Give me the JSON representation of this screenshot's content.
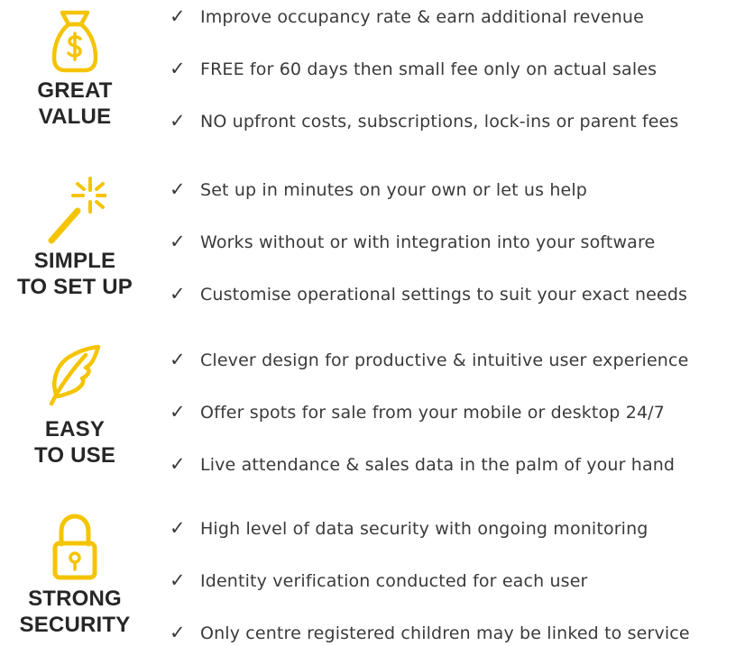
{
  "colors": {
    "accent": "#F5C400",
    "heading": "#262626",
    "body_text": "#3A3A3A"
  },
  "sections": [
    {
      "icon": "money-bag-icon",
      "label_lines": [
        "GREAT",
        "VALUE"
      ],
      "bullets": [
        "Improve occupancy rate & earn additional revenue",
        "FREE for 60 days then small fee only on actual sales",
        "NO upfront costs, subscriptions, lock-ins or parent fees"
      ]
    },
    {
      "icon": "magic-wand-icon",
      "label_lines": [
        "SIMPLE",
        "TO SET UP"
      ],
      "bullets": [
        "Set up in minutes on your own or let us help",
        "Works without or with integration into your software",
        "Customise operational settings to suit your exact needs"
      ]
    },
    {
      "icon": "feather-icon",
      "label_lines": [
        "EASY",
        "TO USE"
      ],
      "bullets": [
        "Clever design for productive & intuitive user experience",
        "Offer spots for sale from your mobile or desktop 24/7",
        "Live attendance & sales data in the palm of your hand"
      ]
    },
    {
      "icon": "padlock-icon",
      "label_lines": [
        "STRONG",
        "SECURITY"
      ],
      "bullets": [
        "High level of data security with ongoing monitoring",
        "Identity verification conducted for each user",
        "Only centre registered children may be linked to service"
      ]
    }
  ]
}
